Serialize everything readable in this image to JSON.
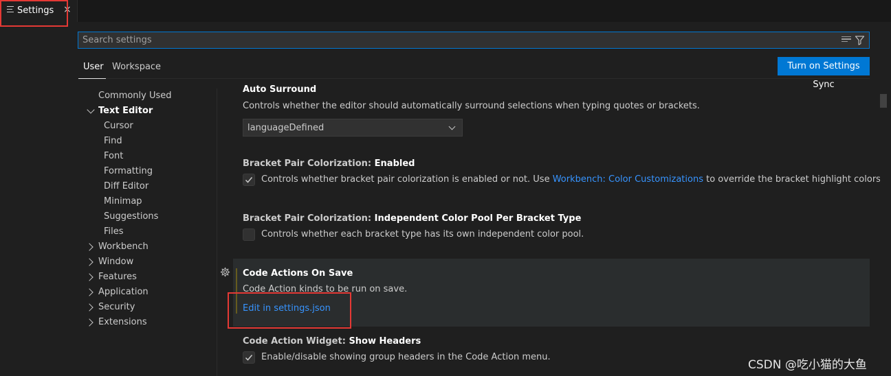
{
  "tab": {
    "title": "Settings",
    "close_glyph": "×",
    "icon": "settings-list-icon"
  },
  "search": {
    "placeholder": "Search settings",
    "value": ""
  },
  "scopes": [
    "User",
    "Workspace"
  ],
  "sync_button": "Turn on Settings Sync",
  "toc": [
    {
      "label": "Commonly Used"
    },
    {
      "label": "Text Editor"
    },
    {
      "label": "Cursor"
    },
    {
      "label": "Find"
    },
    {
      "label": "Font"
    },
    {
      "label": "Formatting"
    },
    {
      "label": "Diff Editor"
    },
    {
      "label": "Minimap"
    },
    {
      "label": "Suggestions"
    },
    {
      "label": "Files"
    },
    {
      "label": "Workbench"
    },
    {
      "label": "Window"
    },
    {
      "label": "Features"
    },
    {
      "label": "Application"
    },
    {
      "label": "Security"
    },
    {
      "label": "Extensions"
    }
  ],
  "settings": {
    "auto_surround": {
      "name": "Auto Surround",
      "description": "Controls whether the editor should automatically surround selections when typing quotes or brackets.",
      "value": "languageDefined"
    },
    "bracket_enabled": {
      "category": "Bracket Pair Colorization: ",
      "name": "Enabled",
      "checked": true,
      "text_before": "Controls whether bracket pair colorization is enabled or not. Use ",
      "link": "Workbench: Color Customizations",
      "text_after": " to override the bracket highlight colors."
    },
    "bracket_pool": {
      "category": "Bracket Pair Colorization: ",
      "name": "Independent Color Pool Per Bracket Type",
      "checked": false,
      "text": "Controls whether each bracket type has its own independent color pool."
    },
    "code_actions": {
      "name": "Code Actions On Save",
      "description": "Code Action kinds to be run on save.",
      "link": "Edit in settings.json"
    },
    "code_action_widget": {
      "category": "Code Action Widget: ",
      "name": "Show Headers",
      "checked": true,
      "text": "Enable/disable showing group headers in the Code Action menu."
    }
  },
  "watermark": "CSDN @吃小猫的大鱼",
  "colors": {
    "accent": "#0078d4",
    "link": "#3794ff",
    "highlight_box": "#e53935",
    "background": "#1f1f1f"
  }
}
